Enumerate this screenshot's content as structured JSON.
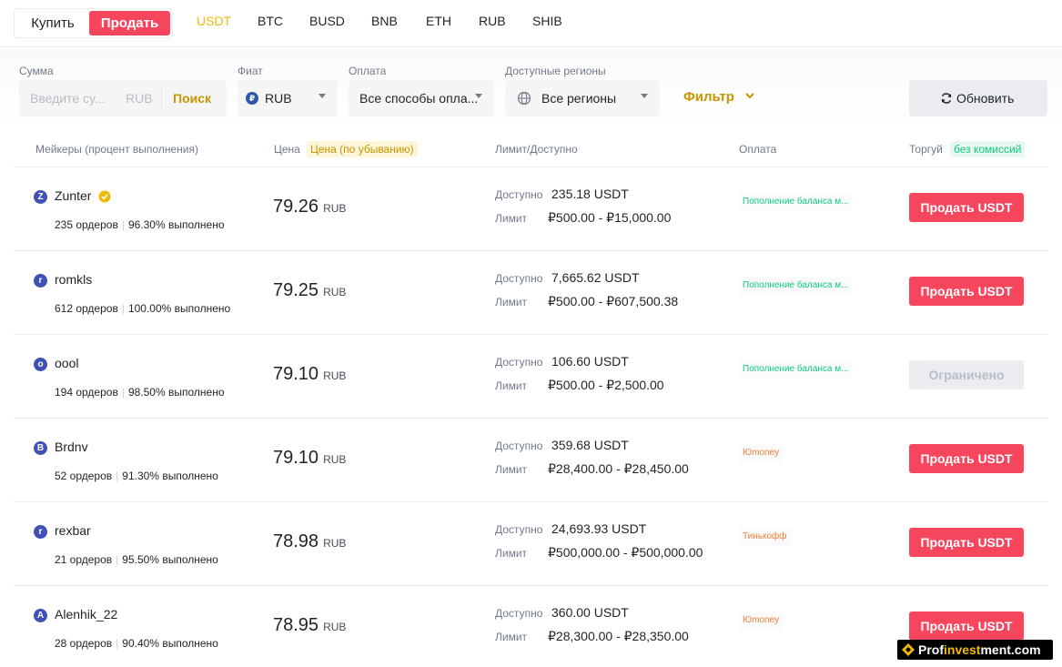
{
  "toggle": {
    "buy_label": "Купить",
    "sell_label": "Продать"
  },
  "coins": [
    "USDT",
    "BTC",
    "BUSD",
    "BNB",
    "ETH",
    "RUB",
    "SHIB"
  ],
  "active_coin": "USDT",
  "filters": {
    "amount_label": "Сумма",
    "amount_placeholder": "Введите су...",
    "amount_currency": "RUB",
    "amount_button": "Поиск",
    "fiat_label": "Фиат",
    "fiat_value": "RUB",
    "fiat_icon_symbol": "₽",
    "payment_label": "Оплата",
    "payment_value": "Все способы опла...",
    "region_label": "Доступные регионы",
    "region_value": "Все регионы",
    "filter_link": "Фильтр",
    "refresh_label": "Обновить"
  },
  "table_header": {
    "makers": "Мейкеры (процент выполнения)",
    "price": "Цена",
    "price_sort": "Цена (по убыванию)",
    "limit": "Лимит/Доступно",
    "payment": "Оплата",
    "trade": "Торгуй",
    "trade_badge": "без комиссий"
  },
  "labels": {
    "available": "Доступно",
    "limit": "Лимит",
    "currency": "RUB"
  },
  "offers": [
    {
      "initial": "Z",
      "name": "Zunter",
      "verified": true,
      "orders": "235 ордеров",
      "completion": "96.30% выполнено",
      "price": "79.26",
      "available": "235.18 USDT",
      "limit": "₽500.00 - ₽15,000.00",
      "payment": "Пополнение баланса м...",
      "payment_color": "green",
      "action": "Продать USDT",
      "action_state": "sell"
    },
    {
      "initial": "r",
      "name": "romkls",
      "verified": false,
      "orders": "612 ордеров",
      "completion": "100.00% выполнено",
      "price": "79.25",
      "available": "7,665.62 USDT",
      "limit": "₽500.00 - ₽607,500.38",
      "payment": "Пополнение баланса м...",
      "payment_color": "green",
      "action": "Продать USDT",
      "action_state": "sell"
    },
    {
      "initial": "o",
      "name": "oool",
      "verified": false,
      "orders": "194 ордеров",
      "completion": "98.50% выполнено",
      "price": "79.10",
      "available": "106.60 USDT",
      "limit": "₽500.00 - ₽2,500.00",
      "payment": "Пополнение баланса м...",
      "payment_color": "green",
      "action": "Ограничено",
      "action_state": "limited"
    },
    {
      "initial": "B",
      "name": "Brdnv",
      "verified": false,
      "orders": "52 ордеров",
      "completion": "91.30% выполнено",
      "price": "79.10",
      "available": "359.68 USDT",
      "limit": "₽28,400.00 - ₽28,450.00",
      "payment": "Юmoney",
      "payment_color": "orange",
      "action": "Продать USDT",
      "action_state": "sell"
    },
    {
      "initial": "r",
      "name": "rexbar",
      "verified": false,
      "orders": "21 ордеров",
      "completion": "95.50% выполнено",
      "price": "78.98",
      "available": "24,693.93 USDT",
      "limit": "₽500,000.00 - ₽500,000.00",
      "payment": "Тинькофф",
      "payment_color": "orange",
      "action": "Продать USDT",
      "action_state": "sell"
    },
    {
      "initial": "A",
      "name": "Alenhik_22",
      "verified": false,
      "orders": "28 ордеров",
      "completion": "90.40% выполнено",
      "price": "78.95",
      "available": "360.00 USDT",
      "limit": "₽28,300.00 - ₽28,350.00",
      "payment": "Юmoney",
      "payment_color": "orange",
      "action": "Продать USDT",
      "action_state": "sell"
    }
  ],
  "watermark": {
    "prefix": "Prof",
    "highlight": "invest",
    "suffix": "ment.com"
  },
  "colors": {
    "accent": "#f0b90b",
    "sell": "#f6465d",
    "link": "#c99400",
    "green": "#0ecb81",
    "orange": "#f0803c"
  }
}
